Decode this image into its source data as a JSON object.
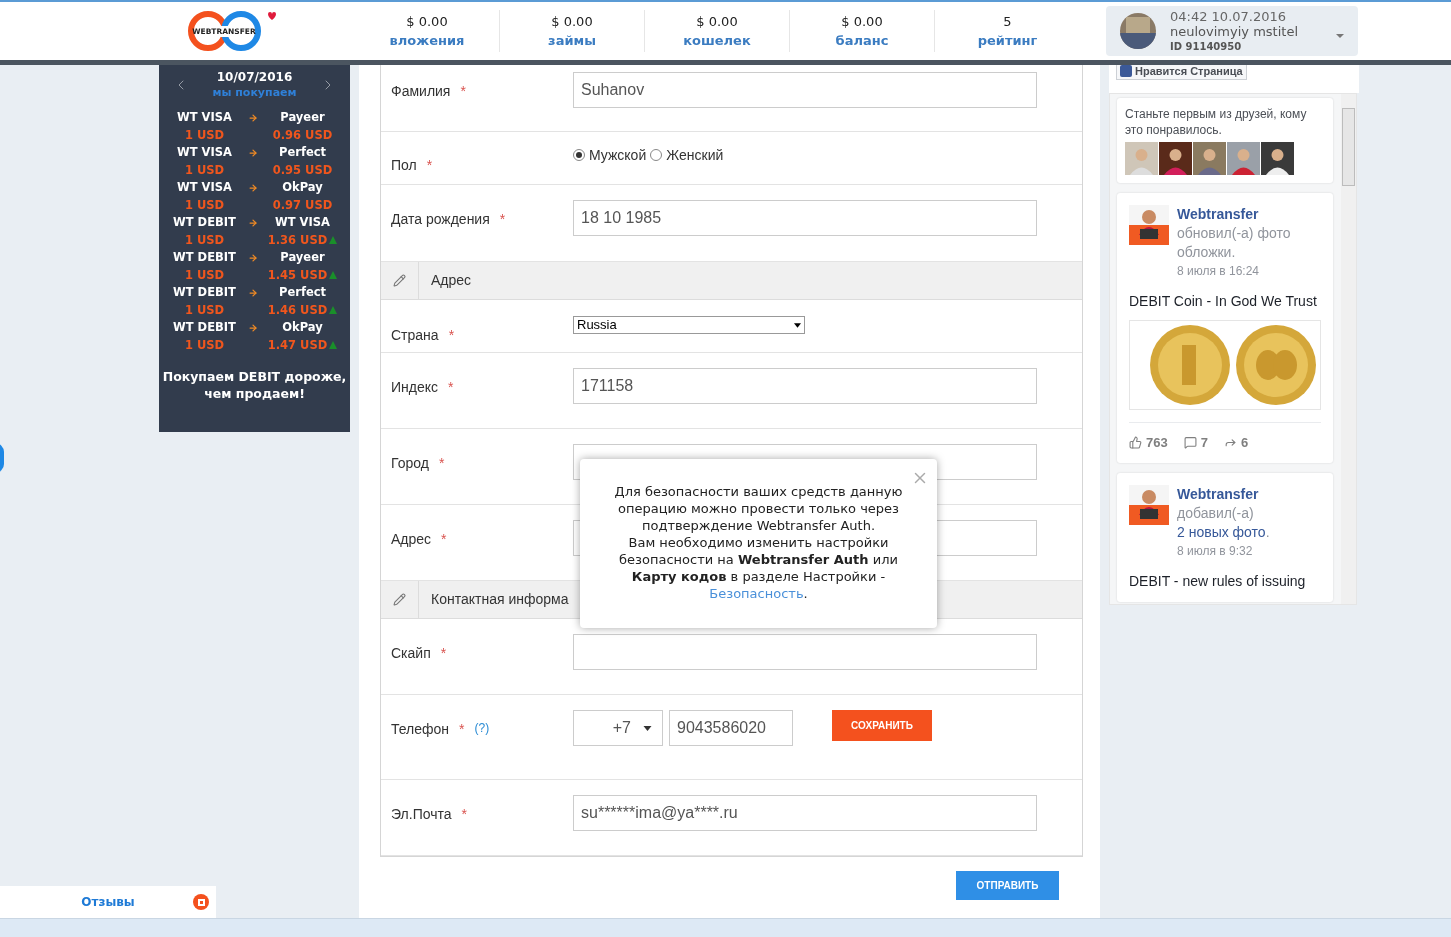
{
  "header": {
    "logo_text": "WEBTRANSFER",
    "stats": [
      {
        "value": "$ 0.00",
        "label": "вложения"
      },
      {
        "value": "$ 0.00",
        "label": "займы"
      },
      {
        "value": "$ 0.00",
        "label": "кошелек"
      },
      {
        "value": "$ 0.00",
        "label": "баланс"
      },
      {
        "value": "5",
        "label": "рейтинг"
      }
    ],
    "user": {
      "time": "04:42 10.07.2016",
      "name": "neulovimyiy mstitel",
      "id": "ID 91140950"
    }
  },
  "rates": {
    "date": "10/07/2016",
    "subtitle": "мы покупаем",
    "rows": [
      {
        "from": "WT VISA",
        "to": "Payeer",
        "from_amount": "1 USD",
        "to_amount": "0.96 USD",
        "trend_up": false
      },
      {
        "from": "WT VISA",
        "to": "Perfect",
        "from_amount": "1 USD",
        "to_amount": "0.95 USD",
        "trend_up": false
      },
      {
        "from": "WT VISA",
        "to": "OkPay",
        "from_amount": "1 USD",
        "to_amount": "0.97 USD",
        "trend_up": false
      },
      {
        "from": "WT DEBIT",
        "to": "WT VISA",
        "from_amount": "1 USD",
        "to_amount": "1.36 USD",
        "trend_up": true
      },
      {
        "from": "WT DEBIT",
        "to": "Payeer",
        "from_amount": "1 USD",
        "to_amount": "1.45 USD",
        "trend_up": true
      },
      {
        "from": "WT DEBIT",
        "to": "Perfect",
        "from_amount": "1 USD",
        "to_amount": "1.46 USD",
        "trend_up": true
      },
      {
        "from": "WT DEBIT",
        "to": "OkPay",
        "from_amount": "1 USD",
        "to_amount": "1.47 USD",
        "trend_up": true
      }
    ],
    "promo": "Покупаем DEBIT дороже, чем продаем!"
  },
  "required_mark": "*",
  "form": [
    {
      "kind": "text",
      "label": "Фамилия",
      "value": "Suhanov"
    },
    {
      "kind": "radio",
      "label": "Пол",
      "options": [
        {
          "label": "Мужской",
          "selected": true
        },
        {
          "label": "Женский",
          "selected": false
        }
      ]
    },
    {
      "kind": "text",
      "label": "Дата рождения",
      "value": "18 10 1985"
    },
    {
      "kind": "section",
      "label": "Адрес"
    },
    {
      "kind": "select",
      "label": "Страна",
      "value": "Russia"
    },
    {
      "kind": "text",
      "label": "Индекс",
      "value": "171158"
    },
    {
      "kind": "text",
      "label": "Город"
    },
    {
      "kind": "text",
      "label": "Адрес"
    },
    {
      "kind": "section",
      "label": "Контактная информа"
    },
    {
      "kind": "text",
      "label": "Скайп"
    },
    {
      "kind": "phone",
      "label": "Телефон",
      "help": "(?)",
      "code": "+7",
      "value": "9043586020",
      "button": "СОХРАНИТЬ"
    },
    {
      "kind": "text",
      "label": "Эл.Почта",
      "value": "su******ima@ya****.ru"
    }
  ],
  "submit": "ОТПРАВИТЬ",
  "popup": {
    "paragraphs": [
      "Для безопасности ваших средств данную операцию можно провести только через подтверждение Webtransfer Auth.",
      "Вам необходимо изменить настройки безопасности на **Webtransfer Auth** или **Карту кодов** в разделе Настройки -"
    ],
    "link": "Безопасность",
    "link_end": "."
  },
  "facebook": {
    "like_button": "Нравится Страница",
    "friends_text": "Станьте первым из друзей, кому это понравилось.",
    "posts": [
      {
        "author": "Webtransfer",
        "action": "обновил(-а) фото обложки.",
        "time": "8 июля в 16:24",
        "text": "DEBIT Coin - In God We Trust",
        "picture": true,
        "likes": "763",
        "comments": "7",
        "shares": "6"
      },
      {
        "author": "Webtransfer",
        "action": "добавил(-а)",
        "link": "2 новых фото",
        "link_end": ".",
        "time": "8 июля в 9:32",
        "text": "DEBIT - new rules of issuing",
        "picture": false
      }
    ]
  },
  "feedback_tab": "Отзывы"
}
